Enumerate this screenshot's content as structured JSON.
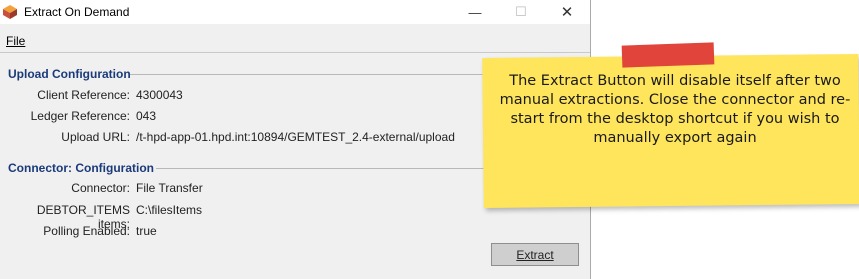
{
  "window": {
    "title": "Extract On Demand",
    "controls": {
      "minimize": "—",
      "maximize": "☐",
      "close": "✕"
    }
  },
  "menu": {
    "file": "File"
  },
  "upload_config": {
    "title": "Upload Configuration",
    "client_reference_label": "Client Reference:",
    "client_reference_value": "4300043",
    "ledger_reference_label": "Ledger Reference:",
    "ledger_reference_value": "043",
    "upload_url_label": "Upload URL:",
    "upload_url_value": "/t-hpd-app-01.hpd.int:10894/GEMTEST_2.4-external/upload"
  },
  "connector_config": {
    "title": "Connector: Configuration",
    "connector_label": "Connector:",
    "connector_value": "File Transfer",
    "debtor_items_label": "DEBTOR_ITEMS items:",
    "debtor_items_value": "C:\\filesItems",
    "polling_label": "Polling Enabled:",
    "polling_value": "true"
  },
  "extract_button": {
    "label": "Extract",
    "enabled": false
  },
  "sticky_note": {
    "text": "The Extract Button will disable itself after two manual extractions.  Close the connector and re-start from the desktop shortcut if you wish to manually export again",
    "note_color": "#ffe55c",
    "tape_color": "#e0443a"
  },
  "colors": {
    "section_title": "#1a3a7a",
    "window_bg": "#f0f0f0"
  },
  "icons": {
    "app": "app-icon"
  }
}
